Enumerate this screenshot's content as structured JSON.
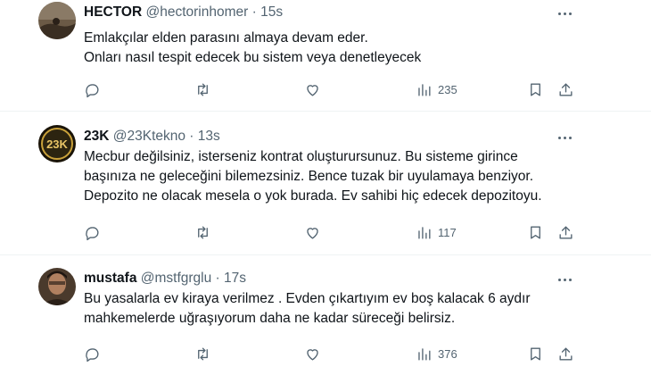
{
  "tweets": [
    {
      "name": "HECTOR",
      "handle": "@hectorinhomer",
      "dot": "·",
      "time": "15s",
      "lines": [
        "Emlakçılar elden parasını almaya devam eder.",
        "Onları nasıl tespit edecek bu sistem veya denetleyecek"
      ],
      "views": "235",
      "avatar_color": "#5a4a3a"
    },
    {
      "name": "23K",
      "handle": "@23Ktekno",
      "dot": "·",
      "time": "13s",
      "lines": [
        "Mecbur değilsiniz, isterseniz kontrat oluşturursunuz. Bu sisteme girince",
        "başınıza ne geleceğini bilemezsiniz. Bence tuzak bir uyulamaya benziyor.",
        "Depozito ne olacak mesela o yok burada. Ev sahibi hiç edecek depozitoyu."
      ],
      "views": "117",
      "avatar_text": "23K",
      "avatar_color": "#1a1408",
      "avatar_accent": "#c9a13a"
    },
    {
      "name": "mustafa",
      "handle": "@mstfgrglu",
      "dot": "·",
      "time": "17s",
      "lines": [
        "Bu yasalarla ev kiraya verilmez . Evden çıkartıyım ev boş kalacak 6 aydır",
        "mahkemelerde uğraşıyorum daha ne kadar süreceği belirsiz."
      ],
      "views": "376",
      "avatar_color": "#3b2f26"
    }
  ],
  "icons": {
    "reply": "reply-icon",
    "retweet": "retweet-icon",
    "like": "heart-icon",
    "views": "views-icon",
    "bookmark": "bookmark-icon",
    "share": "share-icon",
    "more": "more-icon"
  },
  "colors": {
    "text": "#0f1419",
    "secondary": "#536471",
    "divider": "#eff3f4"
  }
}
